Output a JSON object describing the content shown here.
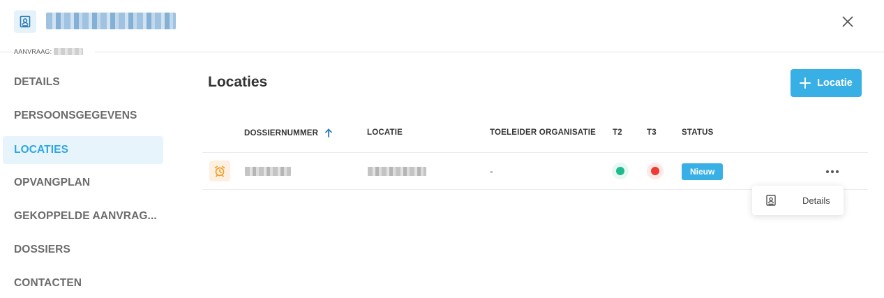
{
  "header": {
    "title_redacted": true,
    "close_icon": "close-icon",
    "person_icon": "contact-card-icon"
  },
  "aanvraag": {
    "label": "AANVRAAG:"
  },
  "sidebar": {
    "items": [
      {
        "label": "DETAILS",
        "active": false
      },
      {
        "label": "PERSOONSGEGEVENS",
        "active": false
      },
      {
        "label": "LOCATIES",
        "active": true
      },
      {
        "label": "OPVANGPLAN",
        "active": false
      },
      {
        "label": "GEKOPPELDE AANVRAG...",
        "active": false
      },
      {
        "label": "DOSSIERS",
        "active": false
      },
      {
        "label": "CONTACTEN",
        "active": false
      }
    ]
  },
  "main": {
    "title": "Locaties",
    "add_button": {
      "label": "Locatie",
      "icon": "plus-icon"
    }
  },
  "table": {
    "columns": [
      "DOSSIERNUMMER",
      "LOCATIE",
      "TOELEIDER ORGANISATIE",
      "T2",
      "T3",
      "STATUS"
    ],
    "sort_icon": "arrow-up-icon",
    "rows": [
      {
        "icon": "alarm-clock-icon",
        "toeleider": "-",
        "t2_color": "#1fba8f",
        "t3_color": "#ee3b34",
        "status": "Nieuw"
      }
    ]
  },
  "context_menu": {
    "items": [
      {
        "label": "Details",
        "icon": "contact-card-icon"
      }
    ]
  },
  "colors": {
    "accent": "#38b0e6",
    "active_bg": "#e8f4fc",
    "warning_icon": "#f39a1e"
  }
}
